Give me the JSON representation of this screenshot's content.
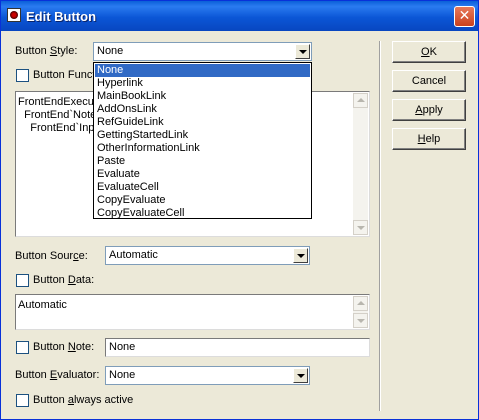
{
  "window": {
    "title": "Edit Button",
    "close_glyph": "✕"
  },
  "button_style": {
    "label_pre": "Button ",
    "label_key": "S",
    "label_post": "tyle:",
    "value": "None"
  },
  "button_function": {
    "label": "Button Funct"
  },
  "function_text": [
    "FrontEndExecut",
    "  FrontEnd`Note",
    "    FrontEnd`Inpu"
  ],
  "dropdown": {
    "selected_index": 0,
    "items": [
      "None",
      "Hyperlink",
      "MainBookLink",
      "AddOnsLink",
      "RefGuideLink",
      "GettingStartedLink",
      "OtherInformationLink",
      "Paste",
      "Evaluate",
      "EvaluateCell",
      "CopyEvaluate",
      "CopyEvaluateCell"
    ]
  },
  "button_source": {
    "label_pre": "Button Sour",
    "label_key": "c",
    "label_post": "e:",
    "value": "Automatic"
  },
  "button_data": {
    "label_pre": "Button ",
    "label_key": "D",
    "label_post": "ata:",
    "text": "Automatic"
  },
  "button_note": {
    "label_pre": "Button ",
    "label_key": "N",
    "label_post": "ote:",
    "value": "None"
  },
  "button_evaluator": {
    "label_pre": "Button ",
    "label_key": "E",
    "label_post": "valuator:",
    "value": "None"
  },
  "always_active": {
    "label_pre": "Button ",
    "label_key": "a",
    "label_post": "lways active"
  },
  "buttons": {
    "ok": {
      "key": "O",
      "rest": "K"
    },
    "cancel": {
      "label": "Cancel"
    },
    "apply": {
      "key": "A",
      "rest": "pply"
    },
    "help": {
      "key": "H",
      "rest": "elp"
    }
  },
  "colors": {
    "title_bar": "#0a5fd8",
    "selection": "#316ac5",
    "dialog_bg": "#ece9d8"
  },
  "icons": {
    "window": "app-icon",
    "close": "close-icon",
    "combo": "chevron-down-icon"
  }
}
